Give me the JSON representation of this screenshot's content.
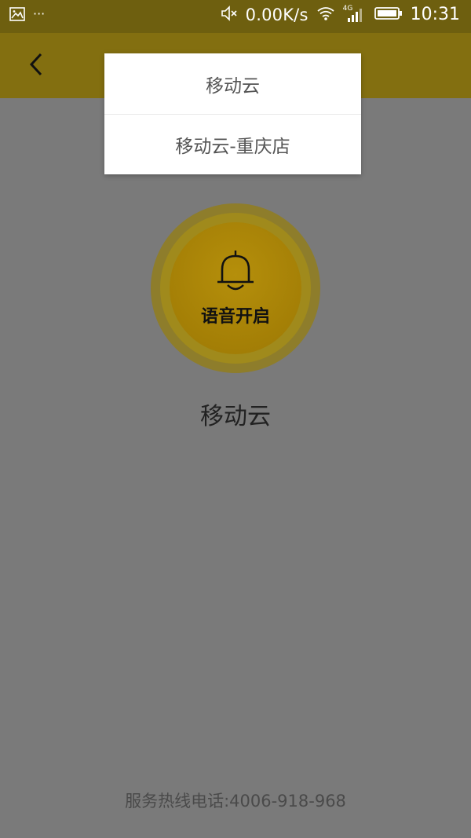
{
  "status_bar": {
    "left_dots": "···",
    "network_speed": "0.00K/s",
    "network_type": "4G",
    "time": "10:31"
  },
  "header": {
    "back_icon": "chevron-left-icon"
  },
  "dropdown": {
    "items": [
      {
        "label": "移动云"
      },
      {
        "label": "移动云-重庆店"
      }
    ]
  },
  "voice_button": {
    "label": "语音开启",
    "icon": "bell-icon"
  },
  "store": {
    "name": "移动云"
  },
  "footer": {
    "hotline": "服务热线电话:4006-918-968"
  },
  "colors": {
    "header_bg": "#836f10",
    "statusbar_bg": "#6e5f0f",
    "overlay_bg": "#7a7a7a",
    "bell_inner": "#a47f06"
  }
}
